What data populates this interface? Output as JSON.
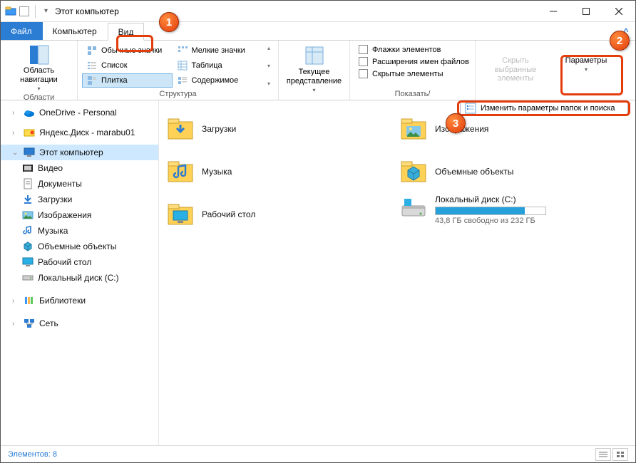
{
  "title": "Этот компьютер",
  "tabs": {
    "file": "Файл",
    "computer": "Компьютер",
    "view": "Вид"
  },
  "ribbon": {
    "groups": {
      "areas": "Области",
      "layout": "Структура",
      "showhide": "Показать/"
    },
    "nav_pane": "Область навигации",
    "layout": {
      "r1a": "Обычные значки",
      "r1b": "Мелкие значки",
      "r2a": "Список",
      "r2b": "Таблица",
      "r3a": "Плитка",
      "r3b": "Содержимое"
    },
    "current_view": "Текущее представление",
    "checks": {
      "c1": "Флажки элементов",
      "c2": "Расширения имен файлов",
      "c3": "Скрытые элементы"
    },
    "hide_sel": "Скрыть выбранные элементы",
    "params": "Параметры",
    "params_menu": "Изменить параметры папок и поиска"
  },
  "sidebar": {
    "onedrive": "OneDrive - Personal",
    "yadisk": "Яндекс.Диск - marabu01",
    "thispc": "Этот компьютер",
    "video": "Видео",
    "docs": "Документы",
    "downloads": "Загрузки",
    "images": "Изображения",
    "music": "Музыка",
    "objects3d": "Объемные объекты",
    "desktop": "Рабочий стол",
    "cdrive": "Локальный диск (C:)",
    "libraries": "Библиотеки",
    "network": "Сеть"
  },
  "content": {
    "downloads": "Загрузки",
    "images": "Изображения",
    "music": "Музыка",
    "objects3d": "Объемные объекты",
    "desktop": "Рабочий стол",
    "cdrive": "Локальный диск (C:)",
    "cdrive_free": "43,8 ГБ свободно из 232 ГБ",
    "cdrive_fill_pct": 81
  },
  "status": {
    "count_label": "Элементов: 8"
  },
  "markers": {
    "m1": "1",
    "m2": "2",
    "m3": "3"
  }
}
